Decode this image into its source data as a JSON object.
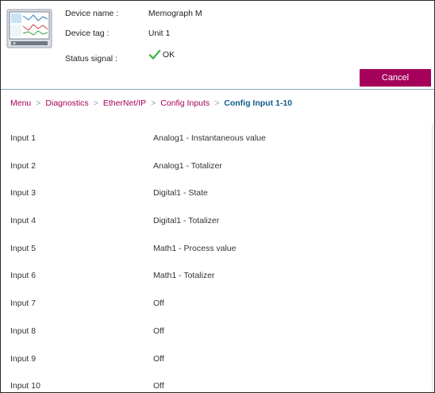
{
  "header": {
    "device_name_label": "Device name :",
    "device_name": "Memograph M",
    "device_tag_label": "Device tag :",
    "device_tag": "Unit 1",
    "status_label": "Status signal :",
    "status_value": "OK",
    "status_icon": "check-icon",
    "accent_color": "#a5005a",
    "status_color": "#3cb043"
  },
  "toolbar": {
    "cancel_label": "Cancel"
  },
  "breadcrumb": {
    "items": [
      "Menu",
      "Diagnostics",
      "EtherNet/IP",
      "Config Inputs"
    ],
    "current": "Config Input 1-10",
    "separator": ">"
  },
  "inputs": [
    {
      "label": "Input 1",
      "value": "Analog1 - Instantaneous value"
    },
    {
      "label": "Input 2",
      "value": "Analog1 - Totalizer"
    },
    {
      "label": "Input 3",
      "value": "Digital1 - State"
    },
    {
      "label": "Input 4",
      "value": "Digital1 - Totalizer"
    },
    {
      "label": "Input 5",
      "value": "Math1 - Process value"
    },
    {
      "label": "Input 6",
      "value": "Math1 - Totalizer"
    },
    {
      "label": "Input 7",
      "value": "Off"
    },
    {
      "label": "Input 8",
      "value": "Off"
    },
    {
      "label": "Input 9",
      "value": "Off"
    },
    {
      "label": "Input 10",
      "value": "Off"
    }
  ]
}
